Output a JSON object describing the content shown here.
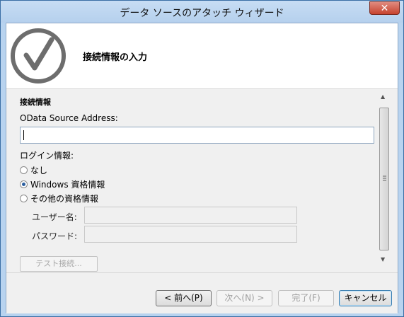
{
  "window": {
    "title": "データ ソースのアタッチ ウィザード",
    "close_glyph": "✕"
  },
  "header": {
    "title": "接続情報の入力",
    "logo_icon": "checkmark-circle-icon"
  },
  "panel": {
    "section_title": "接続情報",
    "address_label": "OData Source Address:",
    "address_value": "",
    "login_label": "ログイン情報:",
    "radio_options": [
      {
        "label": "なし",
        "checked": false
      },
      {
        "label": "Windows 資格情報",
        "checked": true
      },
      {
        "label": "その他の資格情報",
        "checked": false
      }
    ],
    "username_label": "ユーザー名:",
    "password_label": "パスワード:",
    "test_connection_label": "テスト接続..."
  },
  "footer": {
    "back_label": "< 前へ(P)",
    "next_label": "次へ(N) >",
    "finish_label": "完了(F)",
    "cancel_label": "キャンセル"
  }
}
